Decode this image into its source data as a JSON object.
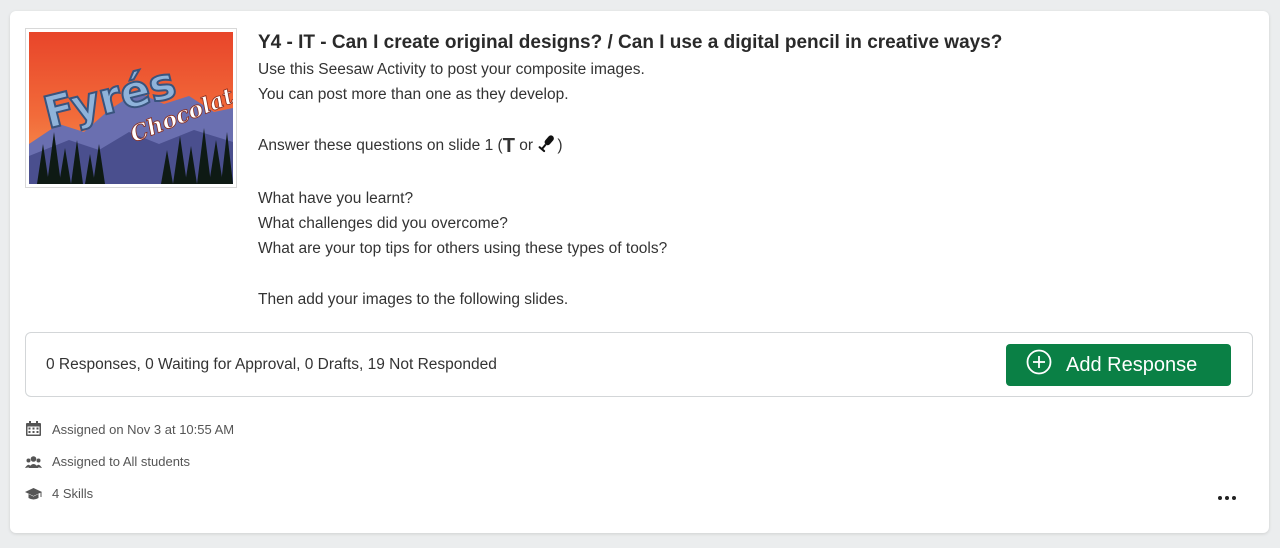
{
  "assignment": {
    "title": "Y4 - IT - Can I create original designs? / Can I use a digital pencil in creative ways?",
    "description_lines": [
      "Use this Seesaw Activity to post your composite images.",
      "You can post more than one as they develop.",
      "",
      "Answer these questions on slide 1 (",
      "",
      "What have you learnt?",
      "What challenges did you overcome?",
      "What are your top tips for others using these types of tools?",
      "",
      "Then add your images to the following slides."
    ],
    "inline_text_glyph": "T",
    "inline_or": " or ",
    "inline_close": ")",
    "thumbnail_text": {
      "word1": "Fyrés",
      "word2": "Chocolate"
    }
  },
  "responses": {
    "summary": "0 Responses, 0 Waiting for Approval, 0 Drafts, 19 Not Responded",
    "add_button_label": "Add Response"
  },
  "meta": {
    "assigned_on": "Assigned on Nov 3 at 10:55 AM",
    "assigned_to": "Assigned to All students",
    "skills": "4 Skills"
  },
  "icons": {
    "calendar": "calendar-icon",
    "users": "users-icon",
    "skills": "graduation-cap-icon",
    "add": "plus-circle-icon",
    "more": "more-horizontal-icon",
    "mic": "microphone-icon"
  },
  "colors": {
    "primary_green": "#0a8045",
    "background": "#ebedee"
  }
}
